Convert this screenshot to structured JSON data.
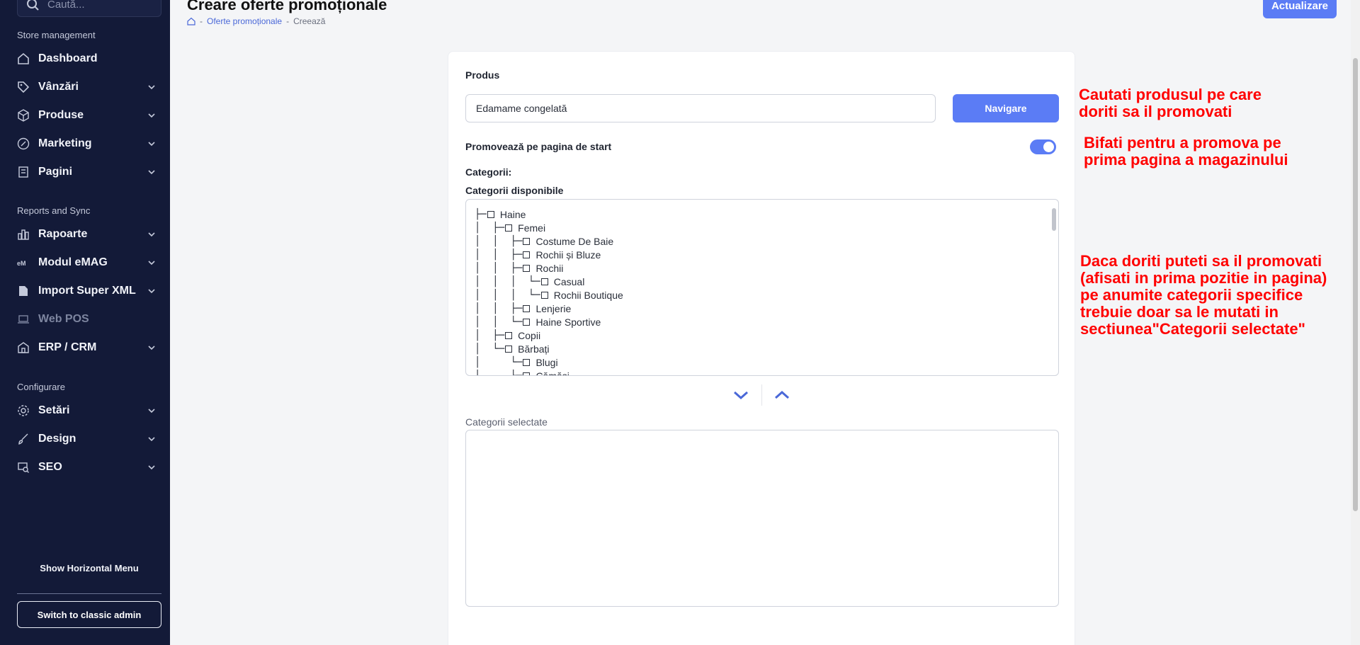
{
  "sidebar": {
    "search_placeholder": "Caută...",
    "sections": {
      "store": "Store management",
      "reports": "Reports and Sync",
      "config": "Configurare"
    },
    "items": [
      {
        "label": "Dashboard",
        "icon": "home-icon"
      },
      {
        "label": "Vânzări",
        "icon": "tag-icon"
      },
      {
        "label": "Produse",
        "icon": "box-icon"
      },
      {
        "label": "Marketing",
        "icon": "percent-icon"
      },
      {
        "label": "Pagini",
        "icon": "pages-icon"
      },
      {
        "label": "Rapoarte",
        "icon": "bar-chart-icon"
      },
      {
        "label": "Modul eMAG",
        "icon": "emag-icon"
      },
      {
        "label": "Import Super XML",
        "icon": "xml-icon"
      },
      {
        "label": "Web POS",
        "icon": "laptop-icon"
      },
      {
        "label": "ERP / CRM",
        "icon": "building-icon"
      },
      {
        "label": "Setări",
        "icon": "gear-icon"
      },
      {
        "label": "Design",
        "icon": "brush-icon"
      },
      {
        "label": "SEO",
        "icon": "seo-icon"
      }
    ],
    "show_horizontal_menu": "Show Horizontal Menu",
    "switch_classic": "Switch to classic admin"
  },
  "header": {
    "title": "Creare oferte promoționale",
    "breadcrumb": {
      "link": "Oferte promoționale",
      "current": "Creează",
      "sep": "-"
    },
    "update_button": "Actualizare"
  },
  "form": {
    "product_label": "Produs",
    "product_value": "Edamame congelată",
    "navigate_button": "Navigare",
    "promote_label": "Promovează pe pagina de start",
    "promote_on": true,
    "categories_label": "Categorii:",
    "available_label": "Categorii disponibile",
    "selected_label": "Categorii selectate",
    "tree": [
      {
        "lines": "├─",
        "label": "Haine"
      },
      {
        "lines": "│  ├─",
        "label": "Femei"
      },
      {
        "lines": "│  │  ├─",
        "label": "Costume De Baie"
      },
      {
        "lines": "│  │  ├─",
        "label": "Rochii și Bluze"
      },
      {
        "lines": "│  │  ├─",
        "label": "Rochii"
      },
      {
        "lines": "│  │  │  └─",
        "label": "Casual"
      },
      {
        "lines": "│  │  │  └─",
        "label": "Rochii Boutique"
      },
      {
        "lines": "│  │  ├─",
        "label": "Lenjerie"
      },
      {
        "lines": "│  │  └─",
        "label": "Haine Sportive"
      },
      {
        "lines": "│  ├─",
        "label": "Copii"
      },
      {
        "lines": "│  └─",
        "label": "Bărbați"
      },
      {
        "lines": "│     └─",
        "label": "Blugi"
      },
      {
        "lines": "│     ├─",
        "label": "Cămăși"
      }
    ]
  },
  "annotations": {
    "a1": "Cautati produsul pe care\ndoriti sa il promovati",
    "a2": "Bifati pentru a promova pe\nprima pagina a magazinului",
    "a3": "Daca doriti puteti sa il promovati\n(afisati in prima pozitie in pagina)\npe anumite categorii specifice\ntrebuie doar sa le mutati in\nsectiunea\"Categorii selectate\""
  },
  "colors": {
    "accent": "#5b7cf5",
    "sidebar": "#131a38",
    "annotation": "#ff0000"
  }
}
